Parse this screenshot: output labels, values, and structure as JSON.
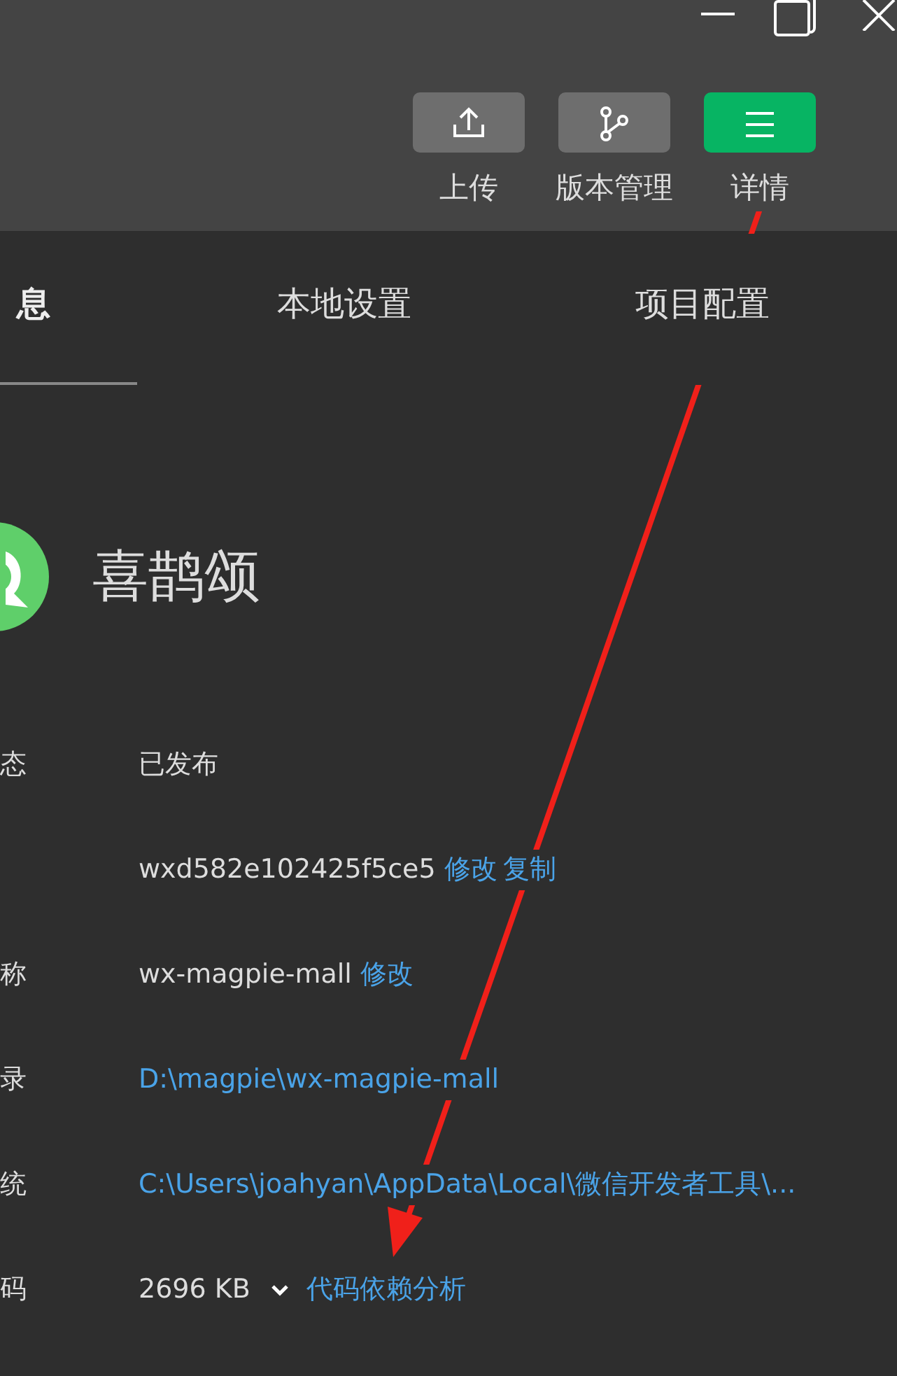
{
  "toolbar": {
    "buttons": [
      {
        "label": "上传",
        "kind": "upload",
        "selected": false
      },
      {
        "label": "版本管理",
        "kind": "branch",
        "selected": false
      },
      {
        "label": "详情",
        "kind": "menu",
        "selected": true
      }
    ]
  },
  "tabs": [
    {
      "label": "息",
      "selected": true
    },
    {
      "label": "本地设置",
      "selected": false
    },
    {
      "label": "项目配置",
      "selected": false
    }
  ],
  "app": {
    "name": "喜鹊颂"
  },
  "fields": [
    {
      "label": "态",
      "value": "已发布",
      "kind": "text"
    },
    {
      "value": "wxd582e102425f5ce5",
      "kind": "text",
      "actions": [
        "修改",
        "复制"
      ]
    },
    {
      "label": "称",
      "value": "wx-magpie-mall",
      "kind": "text",
      "actions": [
        "修改"
      ]
    },
    {
      "label": "录",
      "value": "D:\\magpie\\wx-magpie-mall",
      "kind": "link"
    },
    {
      "label": "统",
      "value": "C:\\Users\\joahyan\\AppData\\Local\\微信开发者工具\\...",
      "kind": "link"
    },
    {
      "label": "码",
      "value": "2696 KB",
      "kind": "dropdown",
      "actions": [
        "代码依赖分析"
      ]
    }
  ]
}
